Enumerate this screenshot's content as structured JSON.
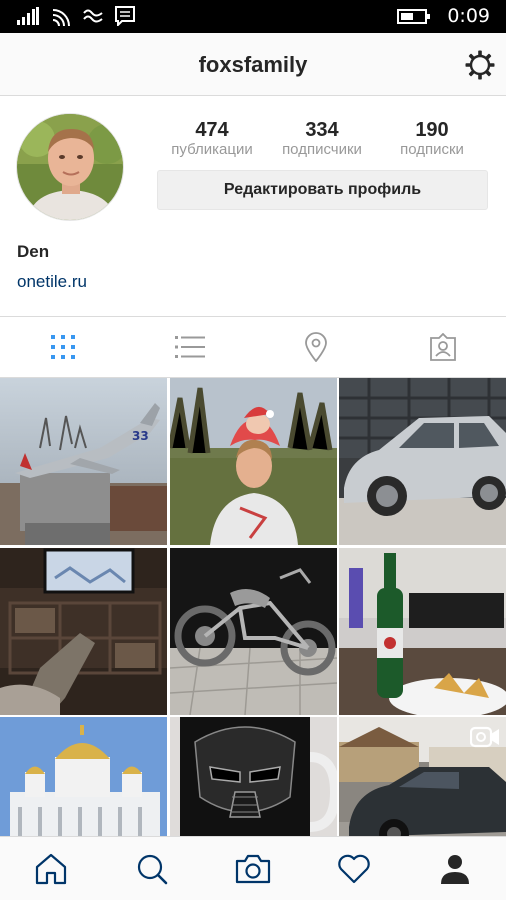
{
  "status_bar": {
    "time": "0:09",
    "battery_level": 0.55
  },
  "header": {
    "username": "foxsfamily"
  },
  "profile": {
    "name": "Den",
    "website": "onetile.ru",
    "edit_label": "Редактировать профиль",
    "stats": [
      {
        "value": "474",
        "label": "публикации"
      },
      {
        "value": "334",
        "label": "подписчики"
      },
      {
        "value": "190",
        "label": "подписки"
      }
    ]
  },
  "tabs": [
    {
      "icon": "grid-icon",
      "active": true
    },
    {
      "icon": "list-icon",
      "active": false
    },
    {
      "icon": "location-pin-icon",
      "active": false
    },
    {
      "icon": "tagged-person-icon",
      "active": false
    }
  ],
  "photos": [
    {
      "subject": "jet-monument"
    },
    {
      "subject": "father-with-baby"
    },
    {
      "subject": "silver-car"
    },
    {
      "subject": "tv-room"
    },
    {
      "subject": "chopper-motorcycle"
    },
    {
      "subject": "beer-bottle"
    },
    {
      "subject": "cathedral",
      "badge": ""
    },
    {
      "subject": "darth-vader-mug"
    },
    {
      "subject": "dark-car",
      "badge": "video-icon"
    }
  ],
  "bottom_nav": [
    {
      "icon": "home-icon"
    },
    {
      "icon": "search-icon"
    },
    {
      "icon": "camera-icon"
    },
    {
      "icon": "heart-icon"
    },
    {
      "icon": "profile-icon",
      "active": true
    }
  ],
  "colors": {
    "accent_blue": "#3897f0",
    "link_blue": "#003569",
    "divider": "#dbdbdb"
  }
}
